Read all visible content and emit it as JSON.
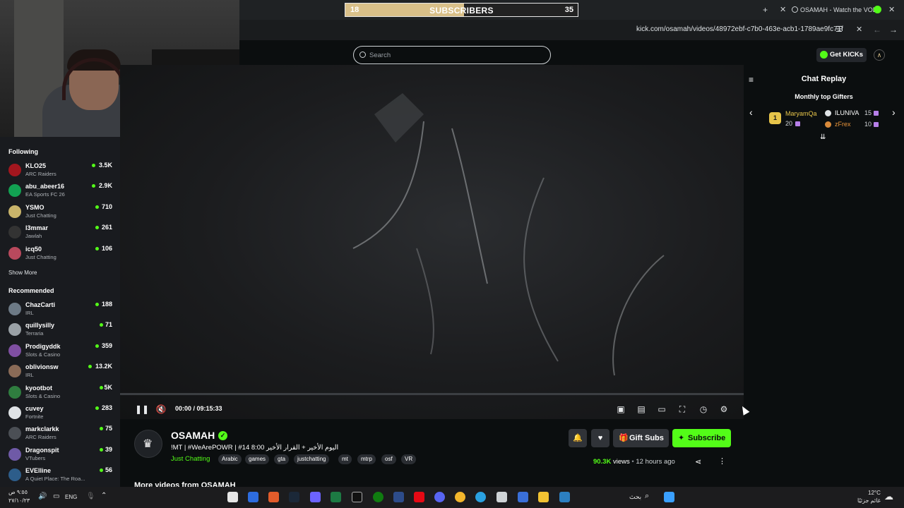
{
  "overlay": {
    "subs_current": "18",
    "subs_label": "SUBSCRIBERS",
    "subs_goal": "35",
    "progress": 0.51
  },
  "browser": {
    "tab_title": "OSAMAH - Watch the VOD",
    "url": "kick.com/osamah/videos/48972ebf-c7b0-463e-acb1-1789ae9fc71f"
  },
  "header": {
    "search_placeholder": "Search",
    "get_kicks": "Get KICKs"
  },
  "sidebar": {
    "following_title": "Following",
    "following": [
      {
        "name": "KLO25",
        "category": "ARC Raiders",
        "viewers": "3.5K",
        "color": "#a2161e"
      },
      {
        "name": "abu_abeer16",
        "category": "EA Sports FC 26",
        "viewers": "2.9K",
        "color": "#12a152"
      },
      {
        "name": "YSMO",
        "category": "Just Chatting",
        "viewers": "710",
        "color": "#c9b46a"
      },
      {
        "name": "l3mmar",
        "category": "Jawlah",
        "viewers": "261",
        "color": "#333"
      },
      {
        "name": "icq50",
        "category": "Just Chatting",
        "viewers": "106",
        "color": "#b9495d"
      }
    ],
    "show_more": "Show More",
    "recommended_title": "Recommended",
    "recommended": [
      {
        "name": "ChazCarti",
        "category": "IRL",
        "viewers": "188",
        "color": "#6d7a86"
      },
      {
        "name": "quillysilly",
        "category": "Terraria",
        "viewers": "71",
        "color": "#9aa1a6"
      },
      {
        "name": "Prodigyddk",
        "category": "Slots & Casino",
        "viewers": "359",
        "color": "#7f4fa2"
      },
      {
        "name": "oblivionsw",
        "category": "IRL",
        "viewers": "13.2K",
        "color": "#8a6b57"
      },
      {
        "name": "kyootbot",
        "category": "Slots & Casino",
        "viewers": "5K",
        "color": "#2f7d3f"
      },
      {
        "name": "cuvey",
        "category": "Fortnite",
        "viewers": "283",
        "color": "#dfe3e6"
      },
      {
        "name": "markclarkk",
        "category": "ARC Raiders",
        "viewers": "75",
        "color": "#4b4f55"
      },
      {
        "name": "Dragonspit",
        "category": "VTubers",
        "viewers": "39",
        "color": "#6f5aa7"
      },
      {
        "name": "EVElline",
        "category": "A Quiet Place: The Roa...",
        "viewers": "56",
        "color": "#2d5d8a"
      }
    ]
  },
  "player": {
    "time": "00:00 / 09:15:33"
  },
  "chat": {
    "title": "Chat Replay",
    "gifters_title": "Monthly top Gifters",
    "gifters": [
      {
        "rank": "1",
        "name": "MaryamQa",
        "count": "20"
      },
      {
        "name": "ILUNIVA",
        "count": "15"
      },
      {
        "name": "zFrex",
        "count": "10"
      }
    ]
  },
  "channel": {
    "name": "OSAMAH",
    "title": "!MT | #WeArePOWR | #14 8:00 اليوم الأخير + القرار الأخير",
    "category": "Just Chatting",
    "tags": [
      "Arabic",
      "games",
      "gta",
      "justchatting",
      "mt",
      "mtrp",
      "osf",
      "VR"
    ],
    "gift_subs": "Gift Subs",
    "subscribe": "Subscribe",
    "views": "90.3K",
    "views_label": "views",
    "ago": "12 hours ago",
    "more_videos": "More videos from OSAMAH"
  },
  "taskbar": {
    "time": "٩:٥٥ ص",
    "date": "٢٧/١٠/٢٣",
    "lang": "ENG",
    "search": "بحث",
    "weather_temp": "12°C",
    "weather_desc": "غائم جزئيًا"
  },
  "colors": {
    "accent": "#53fc18",
    "gold": "#d9c089"
  }
}
